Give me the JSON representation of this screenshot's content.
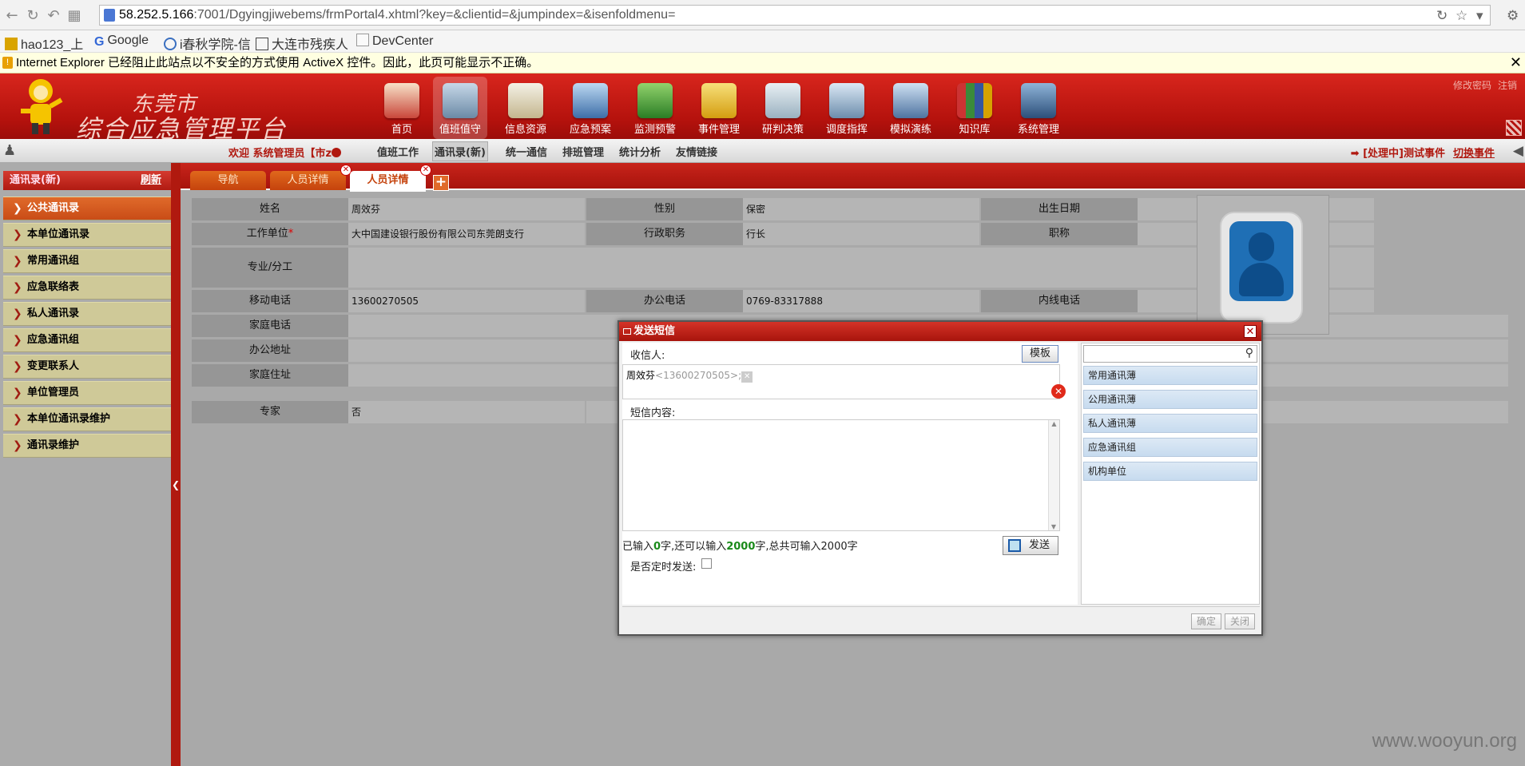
{
  "browser": {
    "url_host": "58.252.5.166",
    "url_path": ":7001/Dgyingjiwebems/frmPortal4.xhtml?key=&clientid=&jumpindex=&isenfoldmenu=",
    "favorites": [
      "hao123_上",
      "Google",
      "i春秋学院-信",
      "大连市残疾人",
      "DevCenter"
    ],
    "infobar": "Internet Explorer 已经阻止此站点以不安全的方式使用 ActiveX 控件。因此，此页可能显示不正确。"
  },
  "header": {
    "brand_line1": "东莞市",
    "brand_line2": "综合应急管理平台",
    "top_links": [
      "修改密码",
      "注销"
    ],
    "nav": [
      "首页",
      "值班值守",
      "信息资源",
      "应急预案",
      "监测预警",
      "事件管理",
      "研判决策",
      "调度指挥",
      "模拟演练",
      "知识库",
      "系统管理"
    ],
    "nav_active": "值班值守"
  },
  "menubar": {
    "welcome": "欢迎 系统管理员【市z",
    "items": [
      "值班工作",
      "通讯录(新)",
      "统一通信",
      "排班管理",
      "统计分析",
      "友情链接"
    ],
    "selected": "通讯录(新)",
    "event_text": "[处理中]测试事件",
    "switch_event": "切换事件"
  },
  "sidebar": {
    "title": "通讯录(新)",
    "refresh": "刷新",
    "items": [
      "公共通讯录",
      "本单位通讯录",
      "常用通讯组",
      "应急联络表",
      "私人通讯录",
      "应急通讯组",
      "变更联系人",
      "单位管理员",
      "本单位通讯录维护",
      "通讯录维护"
    ],
    "selected": "公共通讯录"
  },
  "tabs": [
    "导航",
    "人员详情",
    "人员详情"
  ],
  "detail": {
    "name_label": "姓名",
    "name": "周效芬",
    "gender_label": "性别",
    "gender": "保密",
    "birth_label": "出生日期",
    "birth": "",
    "unit_label": "工作单位",
    "unit": "大中国建设银行股份有限公司东莞朗支行",
    "position_label": "行政职务",
    "position": "行长",
    "title_label": "职称",
    "title": "",
    "specialty_label": "专业/分工",
    "specialty": "",
    "mobile_label": "移动电话",
    "mobile": "13600270505",
    "office_phone_label": "办公电话",
    "office_phone": "0769-83317888",
    "ext_label": "内线电话",
    "ext": "",
    "home_phone_label": "家庭电话",
    "home_phone": "",
    "office_addr_label": "办公地址",
    "office_addr": "",
    "home_addr_label": "家庭住址",
    "home_addr": "",
    "expert_label": "专家",
    "expert": "否"
  },
  "dialog": {
    "title": "发送短信",
    "recipient_label": "收信人:",
    "template_btn": "模板",
    "recipient_name": "周效芬",
    "recipient_phone": "<13600270505>;",
    "content_label": "短信内容:",
    "counter_a": "已输入",
    "counter_n1": "0",
    "counter_b": "字,还可以输入",
    "counter_n2": "2000",
    "counter_c": "字,总共可输入2000字",
    "send_btn": "发送",
    "schedule_label": "是否定时发送:",
    "groups": [
      "常用通讯薄",
      "公用通讯薄",
      "私人通讯薄",
      "应急通讯组",
      "机构单位"
    ],
    "ok_btn": "确定",
    "close_btn": "关闭"
  },
  "watermark": "www.wooyun.org"
}
